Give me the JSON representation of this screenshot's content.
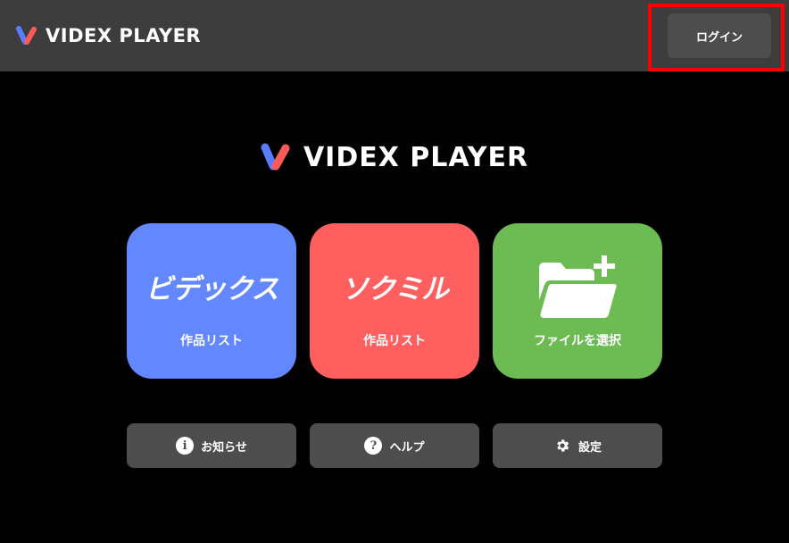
{
  "header": {
    "brand": "VIDEX PLAYER",
    "login_label": "ログイン"
  },
  "hero": {
    "brand": "VIDEX PLAYER"
  },
  "tiles": [
    {
      "logo": "ビデックス",
      "label": "作品リスト",
      "color": "#6287ff"
    },
    {
      "logo": "ソクミル",
      "label": "作品リスト",
      "color": "#ff5f5f"
    },
    {
      "label": "ファイルを選択",
      "icon": "folder-add-icon",
      "color": "#6cbb53"
    }
  ],
  "buttons": {
    "info": {
      "label": "お知らせ",
      "icon": "info-icon"
    },
    "help": {
      "label": "ヘルプ",
      "icon": "help-icon"
    },
    "settings": {
      "label": "設定",
      "icon": "gear-icon"
    }
  },
  "colors": {
    "topbar": "#3d3d3d",
    "highlight": "#ff0000",
    "logo_blue": "#5b7cff",
    "logo_red": "#ff5a5a"
  }
}
